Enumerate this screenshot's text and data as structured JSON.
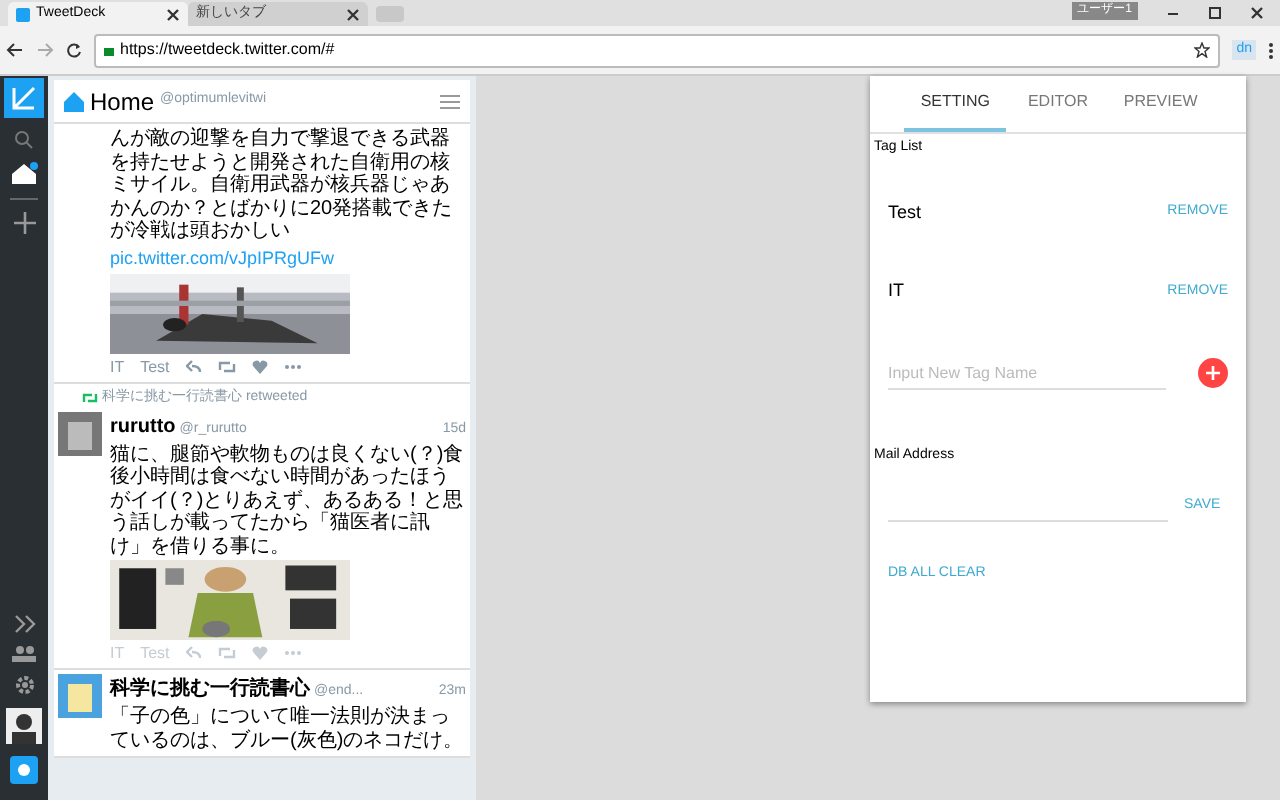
{
  "browser": {
    "tabs": [
      {
        "title": "TweetDeck",
        "selected": true
      },
      {
        "title": "新しいタブ",
        "selected": false
      }
    ],
    "profile": "ユーザー1",
    "url": "https://tweetdeck.twitter.com/#",
    "extension": "dn"
  },
  "column": {
    "title": "Home",
    "handle": "@optimumlevitwi",
    "tweets": [
      {
        "kind": "cut",
        "text": "んが敵の迎撃を自力で撃退できる武器を持たせようと開発された自衛用の核ミサイル。自衛用武器が核兵器じゃあかんのか？とばかりに20発搭載できたが冷戦は頭おかしい",
        "link": "pic.twitter.com/vJpIPRgUFw",
        "tags": [
          "IT",
          "Test"
        ]
      },
      {
        "kind": "retweet",
        "retweeted_by": "科学に挑む一行読書心 retweeted",
        "name": "rurutto",
        "handle": "@r_rurutto",
        "time": "15d",
        "text": "猫に、腿節や軟物ものは良くない(？)食後小時間は食べない時間があったほうがイイ(？)とりあえず、あるある！と思う話しが載ってたから「猫医者に訊け」を借りる事に。",
        "tags": [
          "IT",
          "Test"
        ]
      },
      {
        "kind": "plain",
        "name": "科学に挑む一行読書心",
        "handle": "@end...",
        "time": "23m",
        "text": "「子の色」について唯一法則が決まっているのは、ブルー(灰色)のネコだけ。"
      }
    ]
  },
  "popup": {
    "tabs": [
      {
        "label": "SETTING",
        "selected": true
      },
      {
        "label": "EDITOR",
        "selected": false
      },
      {
        "label": "PREVIEW",
        "selected": false
      }
    ],
    "tag_list_label": "Tag List",
    "tags": [
      {
        "name": "Test",
        "action": "REMOVE"
      },
      {
        "name": "IT",
        "action": "REMOVE"
      }
    ],
    "new_tag": {
      "placeholder": "Input New Tag Name"
    },
    "mail_label": "Mail Address",
    "save": "SAVE",
    "clear": "DB ALL CLEAR"
  }
}
